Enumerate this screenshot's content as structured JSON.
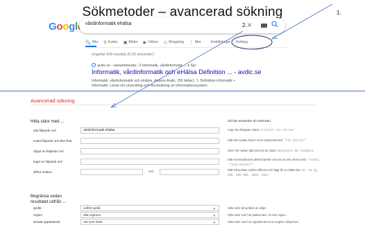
{
  "slide": {
    "title": "Sökmetoder – avancerad sökning",
    "annotations": [
      "1.",
      "2."
    ]
  },
  "google": {
    "logo_letters": [
      "G",
      "o",
      "o",
      "g",
      "l",
      "e"
    ],
    "search": {
      "query": "vårdinformatik ehälsa",
      "clear_icon": "close-icon",
      "keyboard_icon": "keyboard-icon",
      "search_icon": "search-icon"
    },
    "tabs": [
      {
        "label": "Alla",
        "icon": "🔍",
        "active": true
      },
      {
        "label": "Kartor",
        "icon": "⚲",
        "active": false
      },
      {
        "label": "Bilder",
        "icon": "▣",
        "active": false
      },
      {
        "label": "Videor",
        "icon": "▶",
        "active": false
      },
      {
        "label": "Shopping",
        "icon": "◇",
        "active": false
      },
      {
        "label": "Mer",
        "icon": "⋮",
        "active": false
      },
      {
        "label": "Inställningar",
        "icon": "",
        "active": false
      },
      {
        "label": "Verktyg",
        "icon": "",
        "active": false
      }
    ],
    "results_info": "Ungefär 649 resultat (0,35 sekunder)",
    "result": {
      "url": "avdic.se › onewebmedia › 3 Informatik, vårdinformatik ... ▾ Spr",
      "title": "Informatik, vårdinformatik och eHälsa Definition ... - avdic.se",
      "snippet_line1": "Informatik, vårdinformatik och eHälsa. Anders Avdic. (55 bilder). 1. Definition informatik •",
      "snippet_line2": "Informatik: Läran om utveckling och användning av informationssystem."
    }
  },
  "advanced": {
    "title": "Avancerad sökning",
    "section1": {
      "heading": "Hitta sidor med ...",
      "right_heading": "Så här använder du sökrutan.",
      "rows": [
        {
          "label": "alla följande ord:",
          "value": "vårdinformatik ehälsa",
          "hint": "Ange de viktigaste orden: ",
          "hint_ex": "tricolor rat terrier"
        },
        {
          "label": "exakt följande ord eller fras:",
          "value": "",
          "hint": "Sätt den exakta frasen inom citationstecken: ",
          "hint_ex": "\"rat terrier\""
        },
        {
          "label": "något av följande ord:",
          "value": "",
          "hint": "Skriv OR mellan alla ord som du söker: ",
          "hint_ex": "miniature OR standard"
        },
        {
          "label": "inget av följande ord:",
          "value": "",
          "hint": "Sätt ett minustecken direkt framför ord som du inte vill ha med: ",
          "hint_ex": "-rodent, -\"Jack Russell\""
        },
        {
          "label": "siffror mellan:",
          "value": "",
          "till": "och",
          "hint": "Sätt två punkter mellan siffrorna och lägg till en måttenhet: ",
          "hint_ex": "10..35 kg, 300..500 SEK, 2010..2011"
        }
      ]
    },
    "section2": {
      "heading": "Begränsa sedan resultatet utifrån ...",
      "rows": [
        {
          "label": "språk:",
          "value": "valfritt språk",
          "hint": "Hitta sidor på språket du väljer."
        },
        {
          "label": "region:",
          "value": "alla regioner",
          "hint": "Hitta sidor som har publicerats i en viss region."
        },
        {
          "label": "senast uppdaterad:",
          "value": "när som helst",
          "hint": "Hitta sidor som har uppdaterats inom angiven tidsperiod."
        }
      ]
    }
  },
  "colors": {
    "google_blue": "#1a73e8",
    "link": "#1a0dab",
    "adv_title": "#d93025",
    "annotation_line": "#4472c4"
  }
}
